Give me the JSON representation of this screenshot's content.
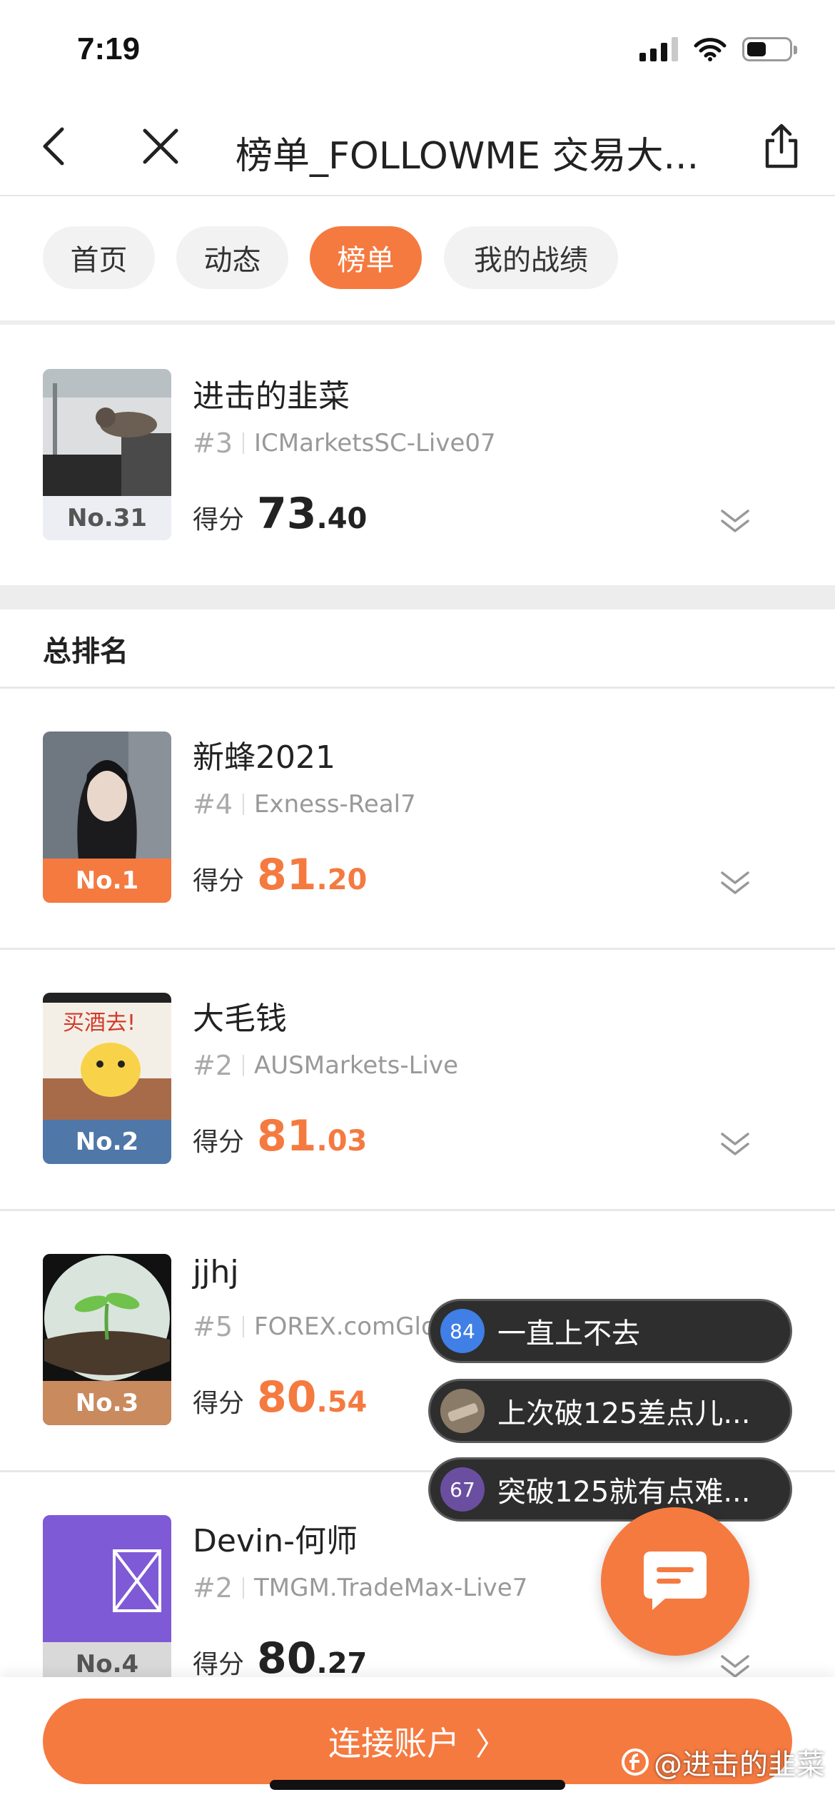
{
  "status_bar": {
    "time": "7:19"
  },
  "nav": {
    "title": "榜单_FOLLOWME 交易大..."
  },
  "tabs": [
    {
      "label": "首页",
      "active": false
    },
    {
      "label": "动态",
      "active": false
    },
    {
      "label": "榜单",
      "active": true
    },
    {
      "label": "我的战绩",
      "active": false
    }
  ],
  "my_entry": {
    "name": "进击的韭菜",
    "rank": "#3",
    "server": "ICMarketsSC-Live07",
    "rank_label": "No.31",
    "score_label": "得分",
    "score_int": "73",
    "score_dec": ".40"
  },
  "section_title": "总排名",
  "entries": [
    {
      "name": "新蜂2021",
      "rank": "#4",
      "server": "Exness-Real7",
      "rank_label": "No.1",
      "score_label": "得分",
      "score_int": "81",
      "score_dec": ".20",
      "tag_color": "#f57a40"
    },
    {
      "name": "大毛钱",
      "rank": "#2",
      "server": "AUSMarkets-Live",
      "rank_label": "No.2",
      "score_label": "得分",
      "score_int": "81",
      "score_dec": ".03",
      "tag_color": "#4f77a8"
    },
    {
      "name": "jjhj",
      "rank": "#5",
      "server": "FOREX.comGlo",
      "rank_label": "No.3",
      "score_label": "得分",
      "score_int": "80",
      "score_dec": ".54",
      "tag_color": "#c98a5e"
    },
    {
      "name": "Devin-何师",
      "rank": "#2",
      "server": "TMGM.TradeMax-Live7",
      "rank_label": "No.4",
      "score_label": "得分",
      "score_int": "80",
      "score_dec": ".27",
      "tag_color": "#d9d9d9"
    }
  ],
  "bubbles": [
    {
      "count": "84",
      "text": "一直上不去",
      "color": "#3f7fe6"
    },
    {
      "count": "",
      "text": "上次破125差点儿...",
      "color": "#7a6a5a"
    },
    {
      "count": "67",
      "text": "突破125就有点难...",
      "color": "#6a4fa0"
    }
  ],
  "connect_button": {
    "label": "连接账户",
    "arrow": "〉"
  },
  "watermark": {
    "text": "@进击的韭菜"
  },
  "colors": {
    "accent": "#f57a40",
    "score_highlight": "#f57a40",
    "score_self": "#222222"
  }
}
